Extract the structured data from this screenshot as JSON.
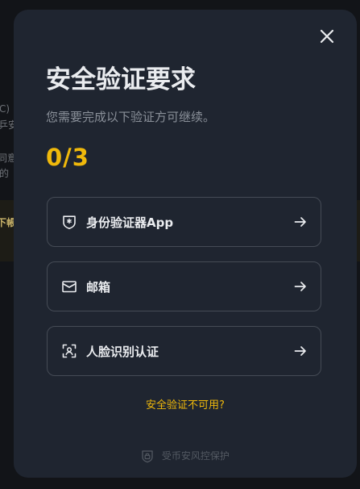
{
  "background": {
    "fragments": [
      "C)",
      "乒安",
      "同意",
      "的",
      "下帳"
    ]
  },
  "modal": {
    "title": "安全验证要求",
    "subtitle": "您需要完成以下验证方可继续。",
    "progress": "0/3",
    "methods": [
      {
        "label": "身份验证器App",
        "icon": "authenticator-shield-icon"
      },
      {
        "label": "邮箱",
        "icon": "envelope-icon"
      },
      {
        "label": "人脸识别认证",
        "icon": "face-scan-icon"
      }
    ],
    "unavailable_link": "安全验证不可用?",
    "footer": "受币安风控保护"
  },
  "colors": {
    "accent": "#f0b90b",
    "modal_bg": "#1f2530",
    "text_primary": "#eaecef",
    "text_secondary": "#8a9099"
  }
}
